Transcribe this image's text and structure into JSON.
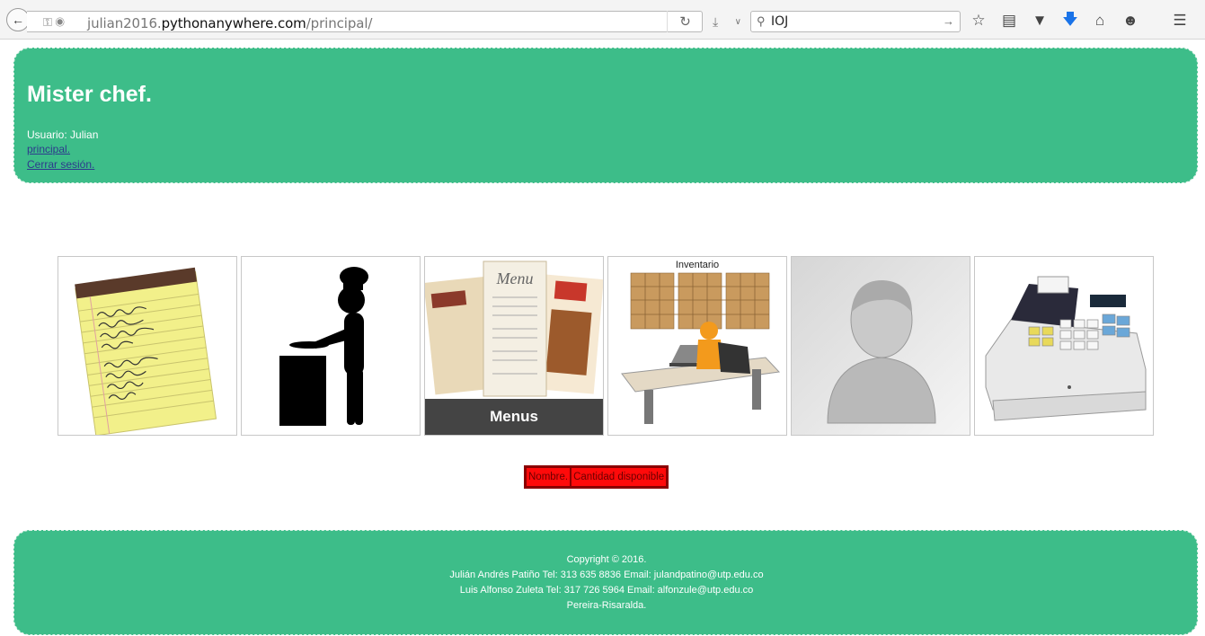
{
  "browser": {
    "url_prefix": "julian2016.",
    "url_domain": "pythonanywhere.com",
    "url_path": "/principal/",
    "search_value": "IOJ"
  },
  "header": {
    "title": "Mister chef.",
    "user_line": "Usuario: Julian",
    "link_principal": "principal.",
    "link_logout": "Cerrar sesión."
  },
  "tiles": [
    {
      "name": "notepad-tile"
    },
    {
      "name": "chef-tile"
    },
    {
      "name": "menus-tile",
      "caption": "Menus"
    },
    {
      "name": "inventario-tile",
      "caption": "Inventario"
    },
    {
      "name": "user-tile"
    },
    {
      "name": "cash-register-tile"
    }
  ],
  "table": {
    "headers": [
      "Nombre.",
      "Cantidad disponible"
    ]
  },
  "colors": {
    "accent": "#3dbd89",
    "table_bg": "#ff0000"
  },
  "footer": {
    "line1": "Copyright © 2016.",
    "line2": "Julián Andrés Patiño Tel: 313 635 8836 Email: julandpatino@utp.edu.co",
    "line3": "Luis Alfonso Zuleta Tel: 317 726 5964 Email: alfonzule@utp.edu.co",
    "line4": "Pereira-Risaralda."
  }
}
